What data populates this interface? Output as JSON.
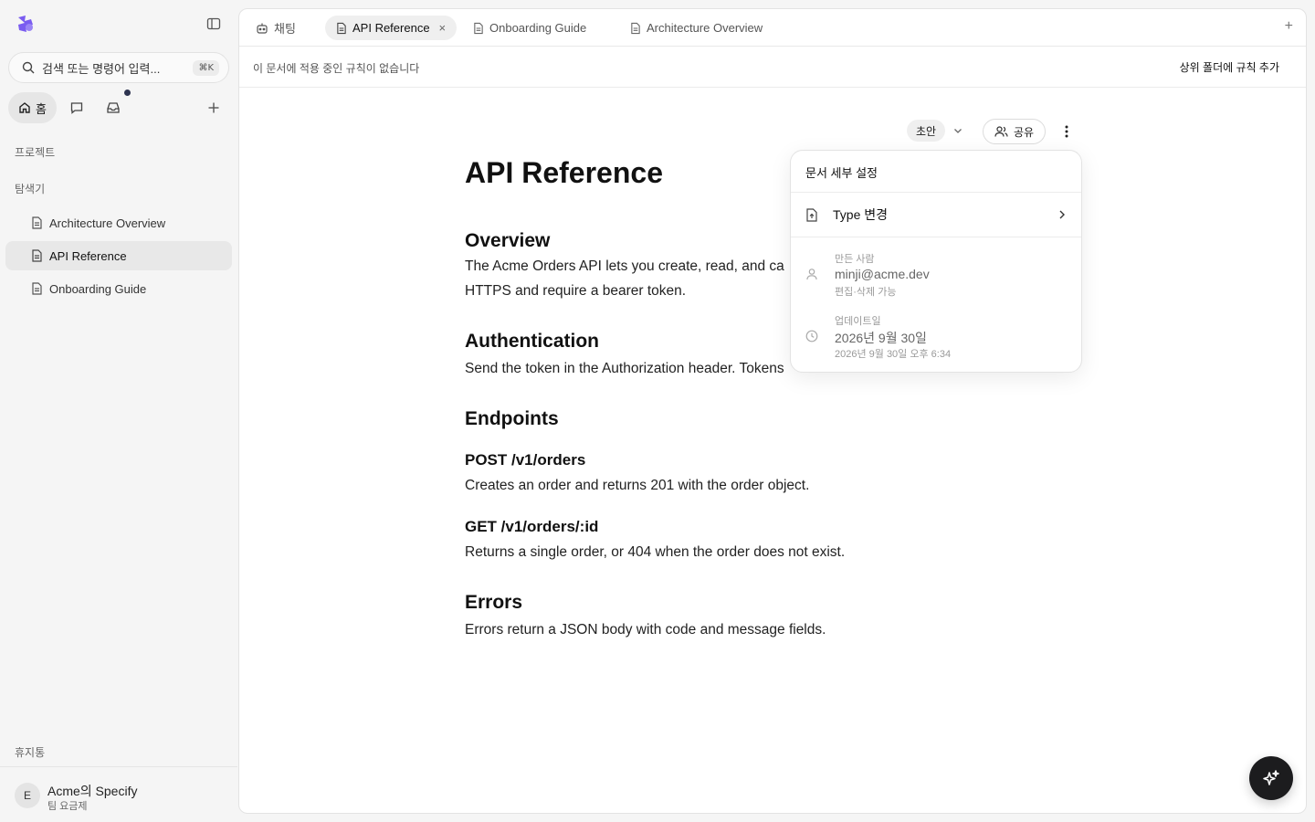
{
  "sidebar": {
    "search": {
      "placeholder": "검색 또는 명령어 입력...",
      "shortcut": "⌘K"
    },
    "home_label": "홈",
    "projects_label": "프로젝트",
    "explorer_label": "탐색기",
    "tree": [
      {
        "label": "Architecture Overview"
      },
      {
        "label": "API Reference",
        "active": true
      },
      {
        "label": "Onboarding Guide"
      }
    ],
    "trash_label": "휴지통",
    "workspace": {
      "initial": "E",
      "name": "Acme의 Specify",
      "plan": "팀 요금제"
    }
  },
  "tabs": [
    {
      "label": "채팅"
    },
    {
      "label": "API Reference",
      "active": true,
      "close": "×"
    },
    {
      "label": "Onboarding Guide"
    },
    {
      "label": "Architecture Overview"
    }
  ],
  "tab_add": "+",
  "rulebar": {
    "text": "이 문서에 적용 중인 규칙이 없습니다",
    "action": "상위 폴더에 규칙 추가"
  },
  "doc_controls": {
    "status": "초안",
    "share": "공유"
  },
  "document": {
    "title": "API Reference",
    "overview_h": "Overview",
    "overview_p": "The Acme Orders API lets you create, read, and ca",
    "overview_p2": "HTTPS and require a bearer token.",
    "auth_h": "Authentication",
    "auth_p": "Send the token in the Authorization header. Tokens",
    "endpoints_h": "Endpoints",
    "post_h": "POST /v1/orders",
    "post_p": "Creates an order and returns 201 with the order object.",
    "get_h": "GET /v1/orders/:id",
    "get_p": "Returns a single order, or 404 when the order does not exist.",
    "errors_h": "Errors",
    "errors_p": "Errors return a JSON body with code and message fields."
  },
  "popover": {
    "title": "문서 세부 설정",
    "type_change": "Type 변경",
    "creator_label": "만든 사람",
    "creator_value": "minji@acme.dev",
    "creator_perm": "편집·삭제 가능",
    "updated_label": "업데이트일",
    "updated_value": "2026년 9월 30일",
    "updated_detail": "2026년 9월 30일 오후 6:34"
  },
  "colors": {
    "fab_bg": "#1c1c1e",
    "logo": "#7a5cf0",
    "notification_dot": "#2e3450"
  }
}
